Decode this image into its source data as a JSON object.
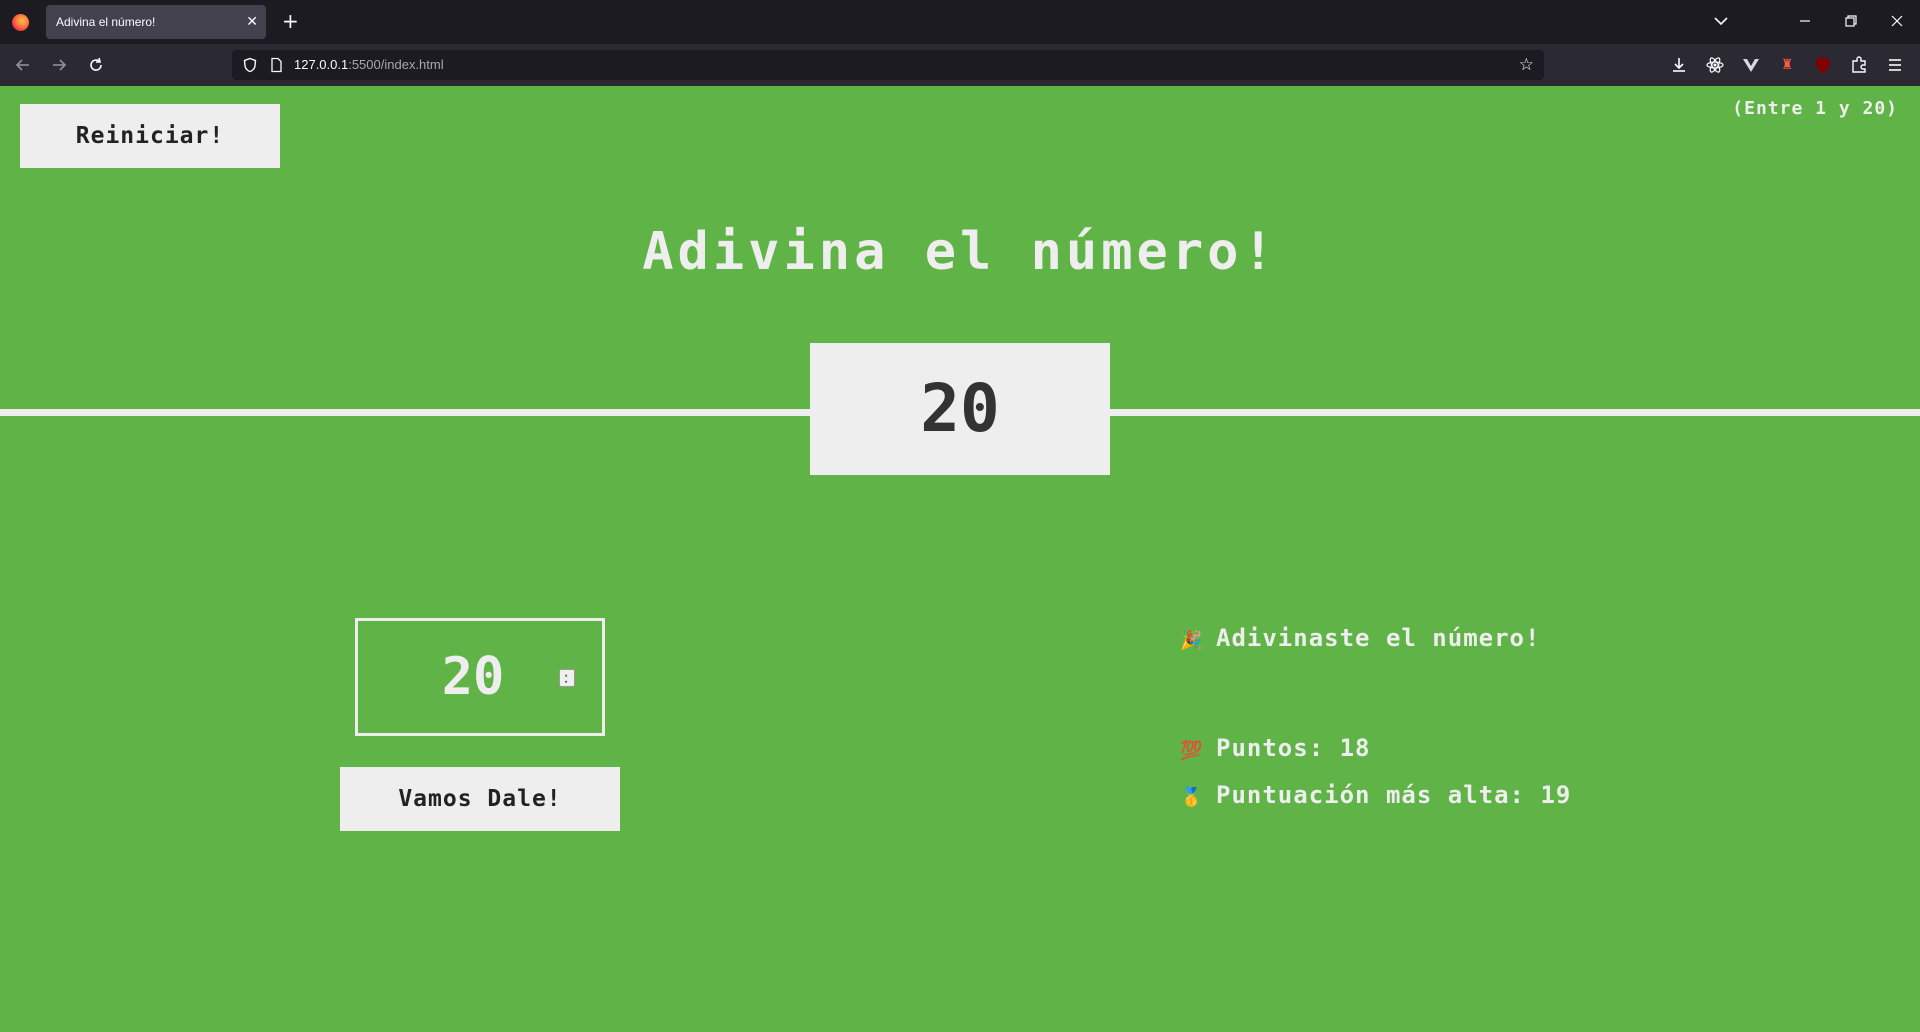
{
  "browser": {
    "tab_title": "Adivina el número!",
    "tab_close": "✕",
    "new_tab": "+",
    "url_host": "127.0.0.1",
    "url_rest": ":5500/index.html"
  },
  "game": {
    "again_label": "Reiniciar!",
    "between": "(Entre 1 y 20)",
    "title": "Adivina el número!",
    "secret_number": "20",
    "guess_value": "20",
    "check_label": "Vamos Dale!",
    "message_icon": "🎉",
    "message": "Adivinaste el número!",
    "score_icon": "💯",
    "score_label": "Puntos:",
    "score": "18",
    "highscore_icon": "🥇",
    "highscore_label": "Puntuación más alta:",
    "highscore": "19"
  },
  "colors": {
    "background": "#60b347",
    "foreground": "#eeeeee",
    "dark_text": "#333333"
  }
}
